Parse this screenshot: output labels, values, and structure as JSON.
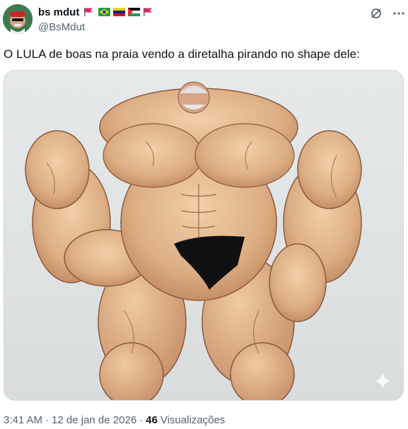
{
  "author": {
    "display_name": "bs mdut",
    "handle": "@BsMdut",
    "flags": [
      "red-flag",
      "brazil-flag",
      "venezuela-flag",
      "palestine-flag",
      "red-flag"
    ]
  },
  "header_icons": {
    "grok": "grok-icon",
    "more": "more-icon"
  },
  "tweet": {
    "text": "O LULA de boas na praia vendo a diretalha pirando no shape dele:"
  },
  "media": {
    "description_icon": "sparkle-icon"
  },
  "meta": {
    "time": "3:41 AM",
    "date": "12 de jan de 2026",
    "separator": "·",
    "views_count": "46",
    "views_label": "Visualizações"
  },
  "colors": {
    "text_primary": "#0f1419",
    "text_secondary": "#536471",
    "border": "#cfd9de",
    "skin": "#e2b48c",
    "trunks": "#111111"
  }
}
